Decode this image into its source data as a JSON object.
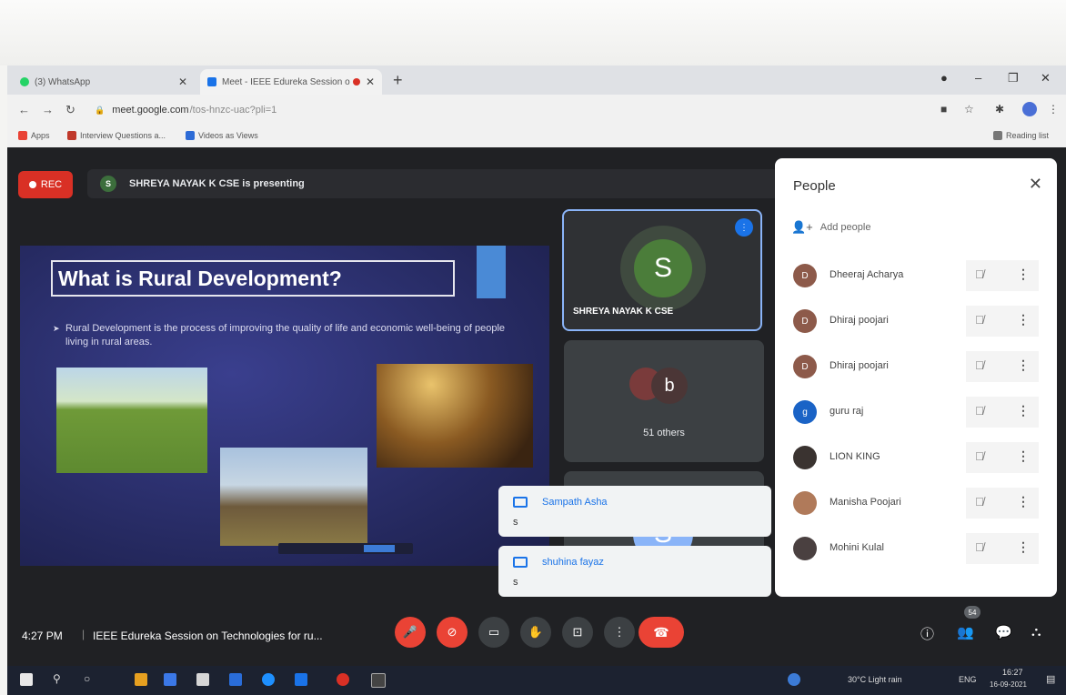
{
  "browser": {
    "tabs": [
      {
        "title": "(3) WhatsApp",
        "fav_color": "#25d366"
      },
      {
        "title": "Meet - IEEE Edureka Session o",
        "fav_color": "#1a73e8"
      }
    ],
    "new_tab": "+",
    "url": {
      "domain": "meet.google.com",
      "path": "/tos-hnzc-uac?pli=1"
    },
    "bookmarks": [
      {
        "label": "Apps",
        "color": "#e94235"
      },
      {
        "label": "Interview Questions a...",
        "color": "#c0392b"
      },
      {
        "label": "Videos as Views",
        "color": "#2d6bd6"
      }
    ],
    "reading_list": "Reading list"
  },
  "meet": {
    "rec_label": "REC",
    "presenter_initial": "S",
    "presenting_text": "SHREYA NAYAK K CSE is presenting",
    "slide": {
      "title": "What is Rural Development?",
      "bullet": "Rural Development is the process of improving the quality of life and economic well-being of people living in rural areas."
    },
    "tiles": {
      "presenter_name": "SHREYA NAYAK K CSE",
      "presenter_initial": "S",
      "others_initial": "b",
      "others_label": "51 others",
      "third_initial": "S"
    },
    "toasts": [
      {
        "sender": "Sampath Asha",
        "message": "s"
      },
      {
        "sender": "shuhina fayaz",
        "message": "s"
      }
    ],
    "people_panel": {
      "title": "People",
      "add_people": "Add people",
      "people": [
        {
          "name": "Dheeraj Acharya",
          "initial": "D",
          "color": "#8d5a4a"
        },
        {
          "name": "Dhiraj poojari",
          "initial": "D",
          "color": "#8d5a4a"
        },
        {
          "name": "Dhiraj poojari",
          "initial": "D",
          "color": "#8d5a4a"
        },
        {
          "name": "guru raj",
          "initial": "g",
          "color": "#1a63c6"
        },
        {
          "name": "LION KING",
          "initial": "",
          "color": "#3a3330"
        },
        {
          "name": "Manisha Poojari",
          "initial": "",
          "color": "#b07a5a"
        },
        {
          "name": "Mohini Kulal",
          "initial": "",
          "color": "#4a4040"
        }
      ]
    },
    "bottom": {
      "time": "4:27 PM",
      "meeting_title": "IEEE Edureka Session on Technologies for ru...",
      "participant_count": "54"
    }
  },
  "taskbar": {
    "weather": "30°C Light rain",
    "lang": "ENG",
    "time": "16:27",
    "date": "16-09-2021"
  }
}
